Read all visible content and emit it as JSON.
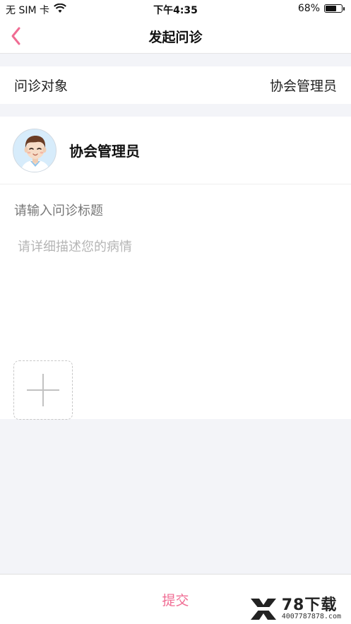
{
  "status_bar": {
    "carrier": "无 SIM 卡",
    "time": "下午4:35",
    "battery_percent": "68%",
    "battery_level": 0.68
  },
  "nav": {
    "title": "发起问诊",
    "back_icon": "chevron-left-icon",
    "accent_color": "#f06c93"
  },
  "consult_target": {
    "label": "问诊对象",
    "value": "协会管理员"
  },
  "user": {
    "name": "协会管理员",
    "avatar_icon": "doctor-avatar"
  },
  "form": {
    "title_placeholder": "请输入问诊标题",
    "description_placeholder": "请详细描述您的病情",
    "add_photo_icon": "plus-icon"
  },
  "footer": {
    "submit_label": "提交",
    "watermark_main": "78下载",
    "watermark_sub": "4007787878.com"
  }
}
